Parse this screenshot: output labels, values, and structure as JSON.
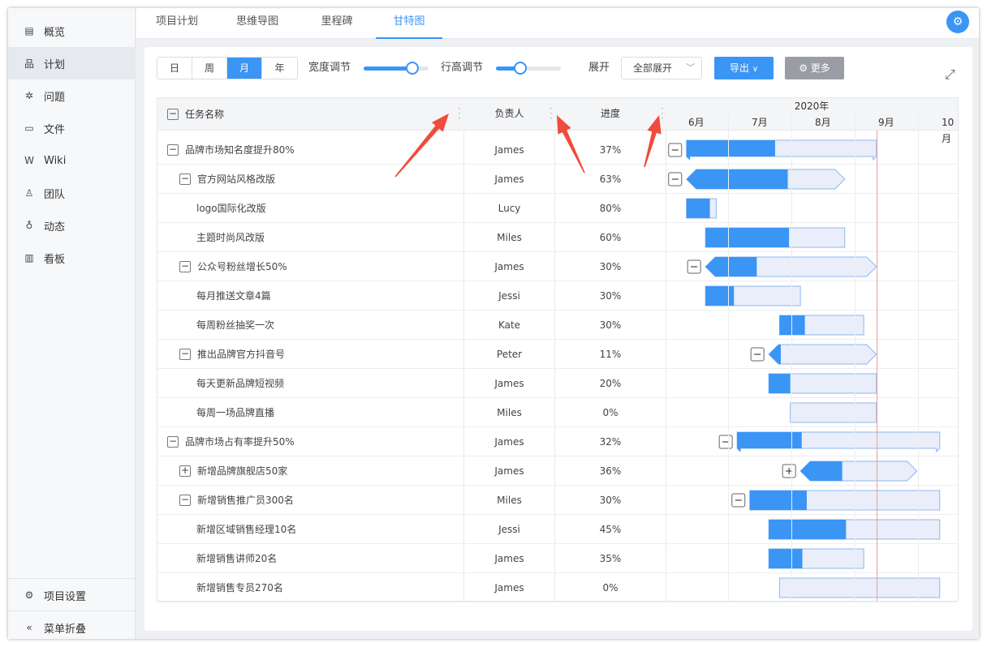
{
  "sidebar": {
    "items": [
      {
        "icon": "▤",
        "label": "概览",
        "name": "overview",
        "active": false
      },
      {
        "icon": "品",
        "label": "计划",
        "name": "plan",
        "active": true
      },
      {
        "icon": "✲",
        "label": "问题",
        "name": "issues",
        "active": false
      },
      {
        "icon": "▭",
        "label": "文件",
        "name": "files",
        "active": false
      },
      {
        "icon": "W",
        "label": "Wiki",
        "name": "wiki",
        "active": false
      },
      {
        "icon": "♙",
        "label": "团队",
        "name": "team",
        "active": false
      },
      {
        "icon": "♁",
        "label": "动态",
        "name": "activity",
        "active": false
      },
      {
        "icon": "▥",
        "label": "看板",
        "name": "board",
        "active": false
      }
    ],
    "settings_label": "项目设置",
    "collapse_label": "菜单折叠"
  },
  "tabs": [
    {
      "label": "项目计划",
      "active": false
    },
    {
      "label": "思维导图",
      "active": false
    },
    {
      "label": "里程碑",
      "active": false
    },
    {
      "label": "甘特图",
      "active": true
    }
  ],
  "toolbar": {
    "scales": [
      {
        "label": "日",
        "active": false
      },
      {
        "label": "周",
        "active": false
      },
      {
        "label": "月",
        "active": true
      },
      {
        "label": "年",
        "active": false
      }
    ],
    "width_label": "宽度调节",
    "width_value": 0.75,
    "height_label": "行高调节",
    "height_value": 0.38,
    "expand_label": "展开",
    "expand_value": "全部展开",
    "export_label": "导出",
    "more_label": "更多"
  },
  "columns": {
    "name": "任务名称",
    "owner": "负责人",
    "progress": "进度"
  },
  "timeline": {
    "year": "2020年",
    "months": [
      "6月",
      "7月",
      "8月",
      "9月",
      "10月"
    ]
  },
  "tasks": [
    {
      "name": "品牌市场知名度提升80%",
      "owner": "James",
      "progress": "37%",
      "level": 0,
      "toggle": "−",
      "bar": {
        "start": 0.33,
        "end": 3.33,
        "done": 1.4,
        "kind": "summary"
      }
    },
    {
      "name": "官方网站风格改版",
      "owner": "James",
      "progress": "63%",
      "level": 1,
      "toggle": "−",
      "bar": {
        "start": 0.33,
        "end": 2.83,
        "done": 1.6,
        "kind": "group"
      }
    },
    {
      "name": "logo国际化改版",
      "owner": "Lucy",
      "progress": "80%",
      "level": 2,
      "toggle": "",
      "bar": {
        "start": 0.33,
        "end": 0.8,
        "done": 0.37,
        "kind": "task"
      }
    },
    {
      "name": "主题时尚风改版",
      "owner": "Miles",
      "progress": "60%",
      "level": 2,
      "toggle": "",
      "bar": {
        "start": 0.63,
        "end": 2.83,
        "done": 1.32,
        "kind": "task"
      }
    },
    {
      "name": "公众号粉丝增长50%",
      "owner": "James",
      "progress": "30%",
      "level": 1,
      "toggle": "−",
      "bar": {
        "start": 0.63,
        "end": 3.33,
        "done": 0.81,
        "kind": "group"
      }
    },
    {
      "name": "每月推送文章4篇",
      "owner": "Jessi",
      "progress": "30%",
      "level": 2,
      "toggle": "",
      "bar": {
        "start": 0.63,
        "end": 2.13,
        "done": 0.45,
        "kind": "task"
      }
    },
    {
      "name": "每周粉丝抽奖一次",
      "owner": "Kate",
      "progress": "30%",
      "level": 2,
      "toggle": "",
      "bar": {
        "start": 1.8,
        "end": 3.13,
        "done": 0.4,
        "kind": "task"
      }
    },
    {
      "name": "推出品牌官方抖音号",
      "owner": "Peter",
      "progress": "11%",
      "level": 1,
      "toggle": "−",
      "bar": {
        "start": 1.63,
        "end": 3.33,
        "done": 0.19,
        "kind": "group"
      }
    },
    {
      "name": "每天更新品牌短视频",
      "owner": "James",
      "progress": "20%",
      "level": 2,
      "toggle": "",
      "bar": {
        "start": 1.63,
        "end": 3.33,
        "done": 0.34,
        "kind": "task"
      }
    },
    {
      "name": "每周一场品牌直播",
      "owner": "Miles",
      "progress": "0%",
      "level": 2,
      "toggle": "",
      "bar": {
        "start": 1.97,
        "end": 3.33,
        "done": 0,
        "kind": "task"
      }
    },
    {
      "name": "品牌市场占有率提升50%",
      "owner": "James",
      "progress": "32%",
      "level": 0,
      "toggle": "−",
      "bar": {
        "start": 1.13,
        "end": 4.33,
        "done": 1.02,
        "kind": "summary"
      }
    },
    {
      "name": "新增品牌旗舰店50家",
      "owner": "James",
      "progress": "36%",
      "level": 1,
      "toggle": "+",
      "bar": {
        "start": 2.13,
        "end": 3.97,
        "done": 0.66,
        "kind": "group"
      }
    },
    {
      "name": "新增销售推广员300名",
      "owner": "Miles",
      "progress": "30%",
      "level": 1,
      "toggle": "−",
      "bar": {
        "start": 1.33,
        "end": 4.33,
        "done": 0.9,
        "kind": "plain"
      }
    },
    {
      "name": "新增区域销售经理10名",
      "owner": "Jessi",
      "progress": "45%",
      "level": 2,
      "toggle": "",
      "bar": {
        "start": 1.63,
        "end": 4.33,
        "done": 1.22,
        "kind": "task"
      }
    },
    {
      "name": "新增销售讲师20名",
      "owner": "James",
      "progress": "35%",
      "level": 2,
      "toggle": "",
      "bar": {
        "start": 1.63,
        "end": 3.13,
        "done": 0.53,
        "kind": "task"
      }
    },
    {
      "name": "新增销售专员270名",
      "owner": "James",
      "progress": "0%",
      "level": 2,
      "toggle": "",
      "bar": {
        "start": 1.8,
        "end": 4.33,
        "done": 0,
        "kind": "task"
      }
    }
  ],
  "today_month_offset": 3.33,
  "colors": {
    "accent": "#3a95f5",
    "bar_bg": "#e9eefa",
    "today": "#f29b9b",
    "arrow": "#f04b3c"
  }
}
